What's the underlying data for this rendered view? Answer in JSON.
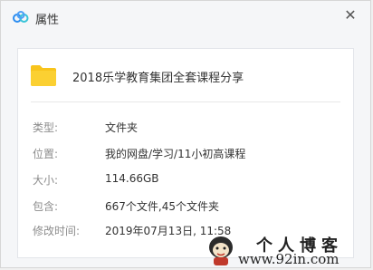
{
  "window": {
    "title": "属性",
    "close_symbol": "✕"
  },
  "file": {
    "name": "2018乐学教育集团全套课程分享",
    "icon": "folder-icon"
  },
  "properties": [
    {
      "label": "类型:",
      "value": "文件夹"
    },
    {
      "label": "位置:",
      "value": "我的网盘/学习/11小初高课程"
    },
    {
      "label": "大小:",
      "value": "114.66GB"
    },
    {
      "label": "包含:",
      "value": "667个文件,45个文件夹"
    },
    {
      "label": "修改时间:",
      "value": "2019年07月13日, 11:58"
    }
  ],
  "watermark": {
    "title": "个人博客",
    "url": "www.92in.com"
  },
  "colors": {
    "folder": "#f8c41c",
    "logo_blue": "#2a8cf0",
    "logo_cyan": "#38c4d8"
  }
}
